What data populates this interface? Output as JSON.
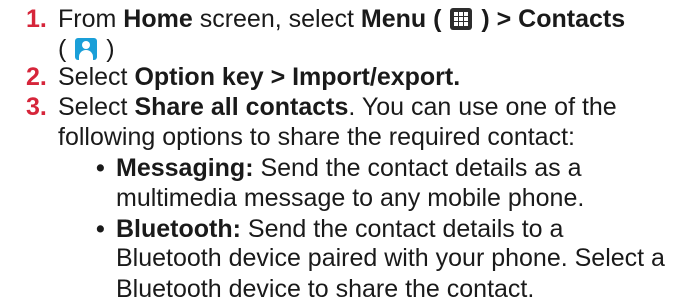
{
  "steps": [
    {
      "number": "1.",
      "lines": [
        {
          "t1": "From ",
          "b1": "Home",
          "t2": " screen, select ",
          "b2": "Menu",
          "t3": " ( ",
          "icon": "menu-grid-icon",
          "b3": " ) > Contacts"
        },
        {
          "t1": "( ",
          "icon": "contacts-icon",
          "t2": " )"
        }
      ]
    },
    {
      "number": "2.",
      "lines": [
        {
          "t1": "Select ",
          "b1": "Option key > Import/export."
        }
      ]
    },
    {
      "number": "3.",
      "lines": [
        {
          "t1": "Select ",
          "b1": "Share all contacts",
          "t2": ". You can use one of the"
        },
        {
          "t1": "following options to share the required contact:"
        }
      ],
      "options": [
        {
          "bullet": "•",
          "label": "Messaging:",
          "text_lines": [
            " Send the contact details as a",
            "multimedia message to any mobile phone."
          ]
        },
        {
          "bullet": "•",
          "label": "Bluetooth:",
          "text_lines": [
            " Send the contact details to a",
            "Bluetooth device paired with your phone. Select a",
            "Bluetooth device to share the contact."
          ]
        }
      ]
    }
  ],
  "colors": {
    "step_number": "#d6253a",
    "text": "#1a1a1a",
    "menu_icon": "#2d2d2d",
    "contacts_icon": "#1a9fd8"
  }
}
